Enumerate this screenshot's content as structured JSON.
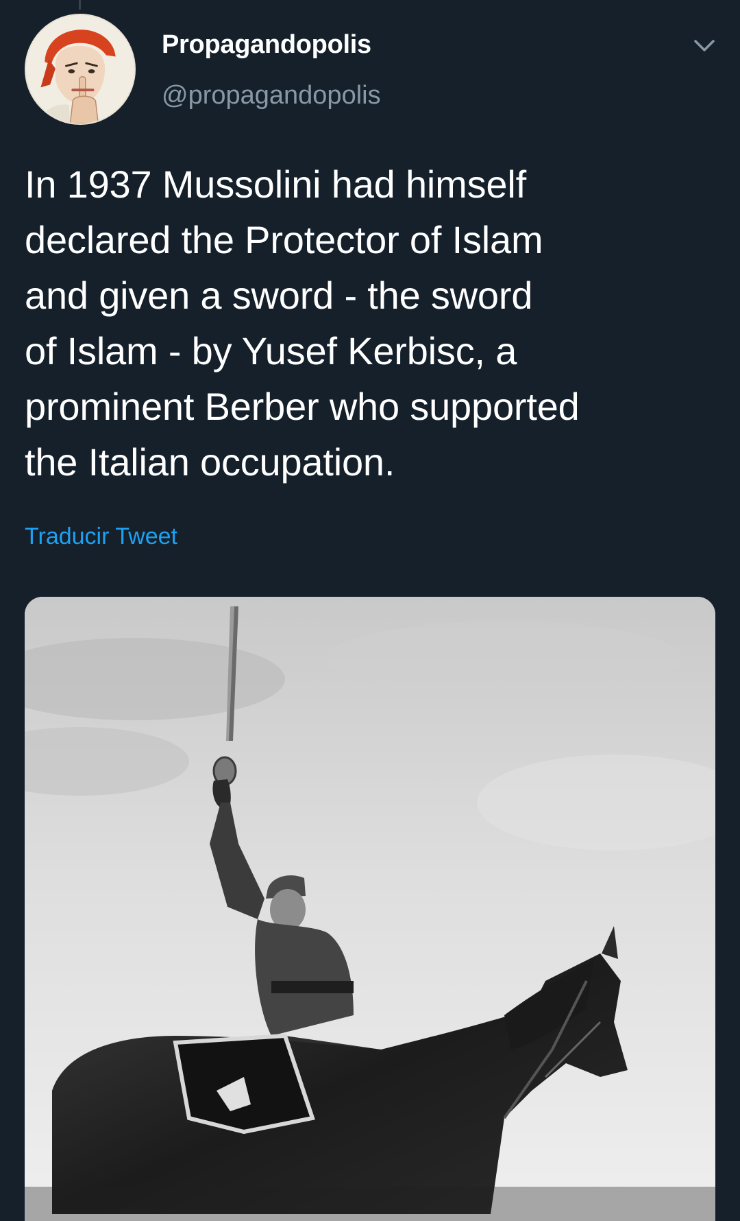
{
  "author": {
    "display_name": "Propagandopolis",
    "handle": "@propagandopolis",
    "avatar": "avatar-poster-woman-shushing"
  },
  "tweet": {
    "text_lines": [
      "In 1937 Mussolini had himself",
      "declared the Protector of Islam",
      "and given a sword - the sword",
      "of Islam - by Yusef Kerbisc, a",
      "prominent Berber who supported",
      "the Italian occupation."
    ],
    "translate_label": "Traducir Tweet"
  },
  "icons": {
    "menu": "chevron-down-icon"
  },
  "media": {
    "description_kind": "photo-equestrian-raised-sword"
  },
  "colors": {
    "background": "#15202b",
    "text": "#ffffff",
    "secondary_text": "#8899a6",
    "link": "#1da1f2"
  }
}
